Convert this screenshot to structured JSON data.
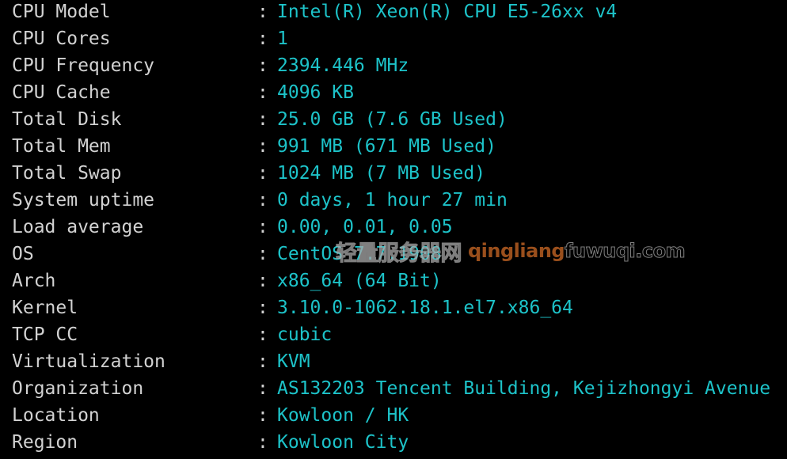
{
  "terminal": {
    "separator": ":",
    "rows": [
      {
        "label": "CPU Model",
        "value": "Intel(R) Xeon(R) CPU E5-26xx v4"
      },
      {
        "label": "CPU Cores",
        "value": "1"
      },
      {
        "label": "CPU Frequency",
        "value": "2394.446 MHz"
      },
      {
        "label": "CPU Cache",
        "value": "4096 KB"
      },
      {
        "label": "Total Disk",
        "value": "25.0 GB (7.6 GB Used)"
      },
      {
        "label": "Total Mem",
        "value": "991 MB (671 MB Used)"
      },
      {
        "label": "Total Swap",
        "value": "1024 MB (7 MB Used)"
      },
      {
        "label": "System uptime",
        "value": "0 days, 1 hour 27 min"
      },
      {
        "label": "Load average",
        "value": "0.00, 0.01, 0.05"
      },
      {
        "label": "OS",
        "value": "CentOS 7.7.1908"
      },
      {
        "label": "Arch",
        "value": "x86_64 (64 Bit)"
      },
      {
        "label": "Kernel",
        "value": "3.10.0-1062.18.1.el7.x86_64"
      },
      {
        "label": "TCP CC",
        "value": "cubic"
      },
      {
        "label": "Virtualization",
        "value": "KVM"
      },
      {
        "label": "Organization",
        "value": "AS132203 Tencent Building, Kejizhongyi Avenue"
      },
      {
        "label": "Location",
        "value": "Kowloon / HK"
      },
      {
        "label": "Region",
        "value": "Kowloon City"
      }
    ]
  },
  "watermark": {
    "chinese": "轻量服务器网",
    "brand": "qingliang",
    "domain": "fuwuqi.com"
  },
  "colors": {
    "background": "#000000",
    "label": "#d2d2d2",
    "value": "#1dc3c9",
    "watermark_brand": "#9a4f1c"
  }
}
